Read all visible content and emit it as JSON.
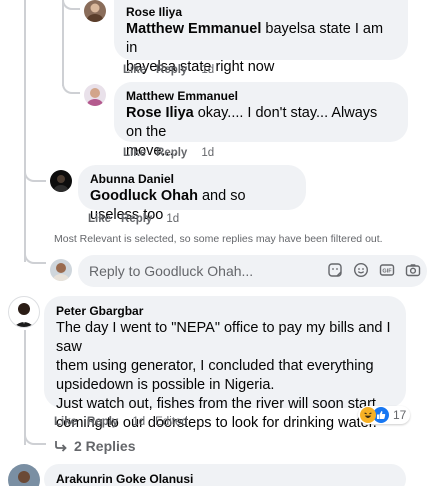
{
  "comments": [
    {
      "name": "Rose Iliya",
      "mention": "Matthew Emmanuel",
      "text_line1": " bayelsa state I am in",
      "text_line2": "bayelsa state right now",
      "like": "Like",
      "reply": "Reply",
      "time": "1d"
    },
    {
      "name": "Matthew Emmanuel",
      "mention": "Rose Iliya",
      "text_line1": " okay.... I don't stay... Always on the",
      "text_line2": "move....",
      "like": "Like",
      "reply": "Reply",
      "time": "1d"
    },
    {
      "name": "Abunna Daniel",
      "mention": "Goodluck Ohah",
      "text_line1": " and so useless too",
      "like": "Like",
      "reply": "Reply",
      "time": "1d"
    }
  ],
  "filter_note": "Most Relevant is selected, so some replies may have been filtered out.",
  "reply_box": {
    "placeholder": "Reply to Goodluck Ohah...",
    "icons": [
      "sticker-icon",
      "emoji-icon",
      "gif-icon",
      "camera-icon"
    ]
  },
  "main_comment": {
    "name": "Peter Gbargbar",
    "lines": [
      "The day I went to \"NEPA\" office to pay my bills and I saw",
      "them using generator, I concluded that everything",
      "upsidedown is possible in Nigeria.",
      "Just watch out, fishes from the river will soon start",
      "coming to our doorsteps to look for drinking water."
    ],
    "like": "Like",
    "reply": "Reply",
    "time": "1d",
    "edited": "Edited",
    "reaction_count": "17",
    "reactions": [
      "haha-icon",
      "like-icon"
    ]
  },
  "replies_link": "2 Replies",
  "next_comment": {
    "name": "Arakunrin Goke Olanusi"
  },
  "colors": {
    "bubble": "#f0f2f5",
    "secondary_text": "#65676b",
    "like_blue": "#1877f2",
    "haha_yellow": "#f7b125"
  }
}
